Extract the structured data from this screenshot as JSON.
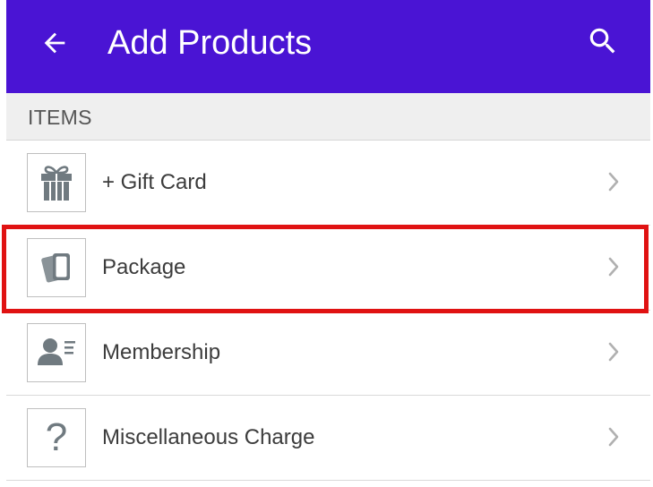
{
  "app_bar": {
    "title": "Add Products",
    "background_color": "#4a14d4",
    "back_icon": "arrow-back-icon",
    "search_icon": "search-icon"
  },
  "section": {
    "title": "ITEMS"
  },
  "items": [
    {
      "label": "+ Gift Card",
      "icon": "gift-icon"
    },
    {
      "label": "Package",
      "icon": "package-cards-icon",
      "highlighted": true
    },
    {
      "label": "Membership",
      "icon": "membership-card-icon"
    },
    {
      "label": "Miscellaneous Charge",
      "icon": "question-mark-icon",
      "glyph": "?"
    }
  ],
  "colors": {
    "highlight_border": "#e01212",
    "icon_gray": "#707a80",
    "chevron_gray": "#b0b0b0"
  }
}
